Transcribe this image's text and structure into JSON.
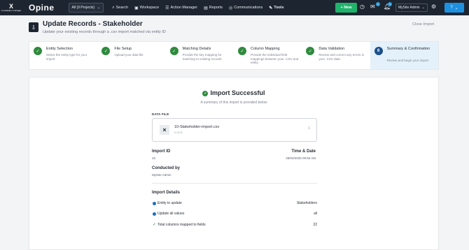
{
  "nav": {
    "brand_mark": "X",
    "brand_text": "consultation manager",
    "logo": "Opine",
    "project_selector": "All (9 Projects)",
    "items": [
      {
        "label": "Search",
        "icon": "search-icon"
      },
      {
        "label": "Workspace",
        "icon": "workspace-icon"
      },
      {
        "label": "Action Manager",
        "icon": "list-icon"
      },
      {
        "label": "Reports",
        "icon": "report-icon"
      },
      {
        "label": "Communications",
        "icon": "communications-icon"
      },
      {
        "label": "Tools",
        "icon": "tools-icon"
      }
    ],
    "new_button": "+ New",
    "messages_badge": "1",
    "notifications_badge": "1",
    "admin_menu": "MySite Admin",
    "help_label": "?"
  },
  "header": {
    "title": "Update Records - Stakeholder",
    "subtitle": "Update your existing records through a .csv import matched via entity ID",
    "close_label": "Close Import"
  },
  "steps": [
    {
      "num": "✓",
      "label": "Entity Selection",
      "desc": "Select the entity type for your import",
      "state": "done"
    },
    {
      "num": "✓",
      "label": "File Setup",
      "desc": "Upload your data file",
      "state": "done"
    },
    {
      "num": "✓",
      "label": "Matching Details",
      "desc": "Provide the key mapping for matching to existing records",
      "state": "done"
    },
    {
      "num": "✓",
      "label": "Column Mapping",
      "desc": "Provide the individual field mappings between your .CSV and entity",
      "state": "done"
    },
    {
      "num": "✓",
      "label": "Data Validation",
      "desc": "Review and correct any errors in your .CSV data",
      "state": "done"
    },
    {
      "num": "6",
      "label": "Summary & Confirmation",
      "desc": "Review and begin your import",
      "state": "active"
    }
  ],
  "summary": {
    "success_title": "Import Successful",
    "success_subtitle": "A summary of this import is provided below",
    "data_file_label": "DATA FILE",
    "file_name": "10-Stakeholder-import.csv",
    "file_size": "0.00 B",
    "import_id_label": "Import ID",
    "import_id": "10",
    "time_date_label": "Time & Date",
    "time_date": "28/03/2025 09:55 AM",
    "conducted_by_label": "Conducted by",
    "conducted_by": "MySite Admin",
    "import_details_label": "Import Details",
    "details": [
      {
        "label": "Entity to update",
        "value": "Stakeholders",
        "marker": "dot"
      },
      {
        "label": "Update all values",
        "value": "all",
        "marker": "dot"
      },
      {
        "label": "Total columns mapped to fields",
        "value": "22",
        "marker": "check"
      }
    ]
  },
  "colors": {
    "nav_bg": "#1d2530",
    "new_button": "#1fb36b",
    "step_done": "#2e8b3e",
    "step_active": "#1d4f8c",
    "help_button": "#1e90e0"
  }
}
